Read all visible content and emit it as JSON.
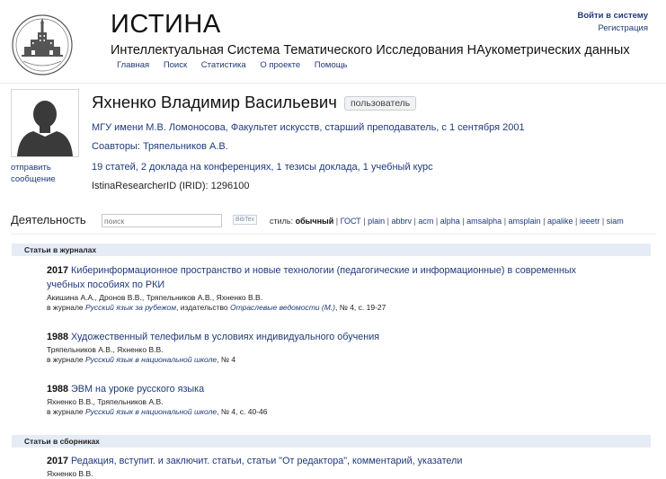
{
  "site": {
    "title": "ИСТИНА",
    "subtitle": "Интеллектуальная Система Тематического Исследования НАукометрических данных",
    "nav": [
      "Главная",
      "Поиск",
      "Статистика",
      "О проекте",
      "Помощь"
    ],
    "login": "Войти в систему",
    "register": "Регистрация"
  },
  "profile": {
    "name": "Яхненко Владимир Васильевич",
    "role_badge": "пользователь",
    "send_message": "отправить сообщение",
    "affiliation": "МГУ имени М.В. Ломоносова, Факультет искусств, старший преподаватель, с 1 сентября 2001",
    "coauthors": "Соавторы: Тряпельников А.В.",
    "counts": "19 статей, 2 доклада на конференциях, 1 тезисы доклада, 1 учебный курс",
    "irid": "IstinaResearcherID (IRID): 1296100"
  },
  "activity": {
    "title": "Деятельность",
    "search_placeholder": "поиск",
    "bibtex": "BibTex",
    "style_label": "стиль:",
    "styles": [
      "обычный",
      "ГОСТ",
      "plain",
      "abbrv",
      "acm",
      "alpha",
      "amsalpha",
      "amsplain",
      "apalike",
      "ieeetr",
      "siam"
    ],
    "active_style": "обычный"
  },
  "sections": [
    {
      "heading": "Статьи в журналах",
      "items": [
        {
          "year": "2017",
          "title": "Киберинформационное пространство и новые технологии (педагогические и информационные) в современных учебных пособиях по РКИ",
          "authors": "Акишина А.А., Дронов В.В., Тряпельников А.В., Яхненко В.В.",
          "src_prefix": "в журнале ",
          "journal": "Русский язык за рубежом",
          "src_mid": ", издательство ",
          "publisher": "Отраслевые ведомости (М.)",
          "src_suffix": ", № 4, с. 19-27"
        },
        {
          "year": "1988",
          "title": "Художественный телефильм в условиях индивидуального обучения",
          "authors": "Тряпельников А.В., Яхненко В.В.",
          "src_prefix": "в журнале ",
          "journal": "Русский язык в национальной школе",
          "src_suffix": ", № 4"
        },
        {
          "year": "1988",
          "title": "ЭВМ на уроке русского языка",
          "authors": "Яхненко В.В., Тряпельников А.В.",
          "src_prefix": "в журнале ",
          "journal": "Русский язык в национальной школе",
          "src_suffix": ", № 4, с. 40-46"
        }
      ]
    },
    {
      "heading": "Статьи в сборниках",
      "items": [
        {
          "year": "2017",
          "title": "Редакция, вступит. и заключит. статьи, статьи \"От редактора\", комментарий, указатели",
          "authors": "Яхненко В.В."
        }
      ]
    }
  ]
}
